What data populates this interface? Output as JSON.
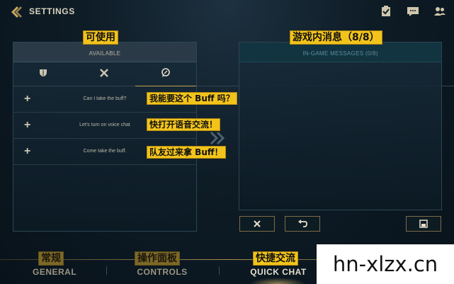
{
  "header": {
    "title": "SETTINGS"
  },
  "labels_zh": {
    "available": "可使用",
    "in_game_messages": "游戏内消息（8/8）",
    "general": "常规",
    "controls": "操作面板",
    "quick_chat": "快捷交流"
  },
  "left_panel": {
    "title": "AVAILABLE",
    "tabs": [
      {
        "icon": "shield-icon"
      },
      {
        "icon": "crossed-swords-icon"
      },
      {
        "icon": "chat-bubble-icon",
        "selected": true
      }
    ],
    "rows": [
      {
        "text": "Can I take the buff?",
        "zh": "我能要这个 Buff 吗？"
      },
      {
        "text": "Let's turn on voice chat",
        "zh": "快打开语音交流！"
      },
      {
        "text": "Come take the buff.",
        "zh": "队友过来拿 Buff！"
      }
    ]
  },
  "right_panel": {
    "title": "IN-GAME MESSAGES (0/8)",
    "buttons": [
      {
        "icon": "close-icon"
      },
      {
        "icon": "undo-icon"
      },
      {
        "icon": "save-icon"
      }
    ]
  },
  "nav": {
    "items": [
      {
        "label": "GENERAL"
      },
      {
        "label": "CONTROLS"
      },
      {
        "label": "QUICK CHAT",
        "active": true
      }
    ]
  },
  "watermark": {
    "text": "hn-xlzx.cn"
  },
  "colors": {
    "accent_gold": "#f2c41b",
    "frame_gold": "#c8a24a",
    "background": "#0e1c26"
  }
}
